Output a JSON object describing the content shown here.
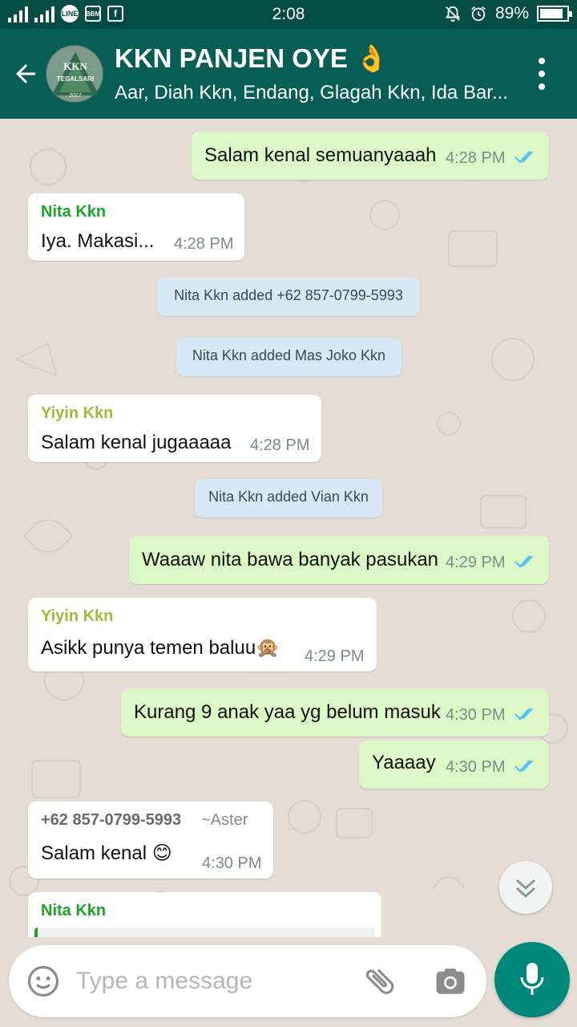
{
  "status_bar": {
    "time": "2:08",
    "battery": "89%",
    "battery_level": 0.89,
    "line_badge": "LINE",
    "bb_icon": "BBM",
    "fb_icon": "f"
  },
  "header": {
    "title": "KKN PANJEN OYE 👌",
    "subtitle": "Aar, Diah Kkn, Endang, Glagah Kkn, Ida Bar...",
    "avatar_text": "KKN",
    "avatar_subtext": "TEGALSARI",
    "avatar_year": "2017"
  },
  "messages": [
    {
      "type": "out",
      "text": "Salam kenal semuanyaaah",
      "time": "4:28 PM"
    },
    {
      "type": "in",
      "sender": "Nita Kkn",
      "text": "Iya. Makasi...",
      "time": "4:28 PM"
    },
    {
      "type": "system",
      "text": "Nita Kkn added +62 857-0799-5993"
    },
    {
      "type": "system",
      "text": "Nita Kkn added Mas Joko Kkn"
    },
    {
      "type": "in",
      "sender": "Yiyin Kkn",
      "text": "Salam kenal jugaaaaa",
      "time": "4:28 PM"
    },
    {
      "type": "system",
      "text": "Nita Kkn added Vian Kkn"
    },
    {
      "type": "out",
      "text": "Waaaw nita bawa banyak pasukan",
      "time": "4:29 PM"
    },
    {
      "type": "in",
      "sender": "Yiyin Kkn",
      "text": "Asikk punya temen baluu🙊",
      "time": "4:29 PM"
    },
    {
      "type": "out",
      "text": "Kurang 9 anak yaa yg belum masuk",
      "time": "4:30 PM"
    },
    {
      "type": "out",
      "text": "Yaaaay",
      "time": "4:30 PM"
    },
    {
      "type": "in",
      "sender": "+62 857-0799-5993",
      "sender_alt": "~Aster",
      "text": "Salam kenal 😊",
      "time": "4:30 PM"
    },
    {
      "type": "in",
      "sender": "Nita Kkn",
      "text": "",
      "time": ""
    }
  ],
  "colors": {
    "header": "#075e54",
    "status_bar": "#054d44",
    "outgoing": "#dcf8c6",
    "incoming": "#ffffff",
    "system": "#d6e9f5",
    "tick_read": "#4fc3f7",
    "sender_green": "#1fa32a",
    "sender_olive": "#a5b83a",
    "mic": "#00897b"
  },
  "input": {
    "placeholder": "Type a message",
    "value": ""
  },
  "icons": [
    "back-arrow-icon",
    "more-vert-icon",
    "double-tick-icon",
    "scroll-down-icon",
    "emoji-icon",
    "attach-icon",
    "camera-icon",
    "mic-icon"
  ]
}
